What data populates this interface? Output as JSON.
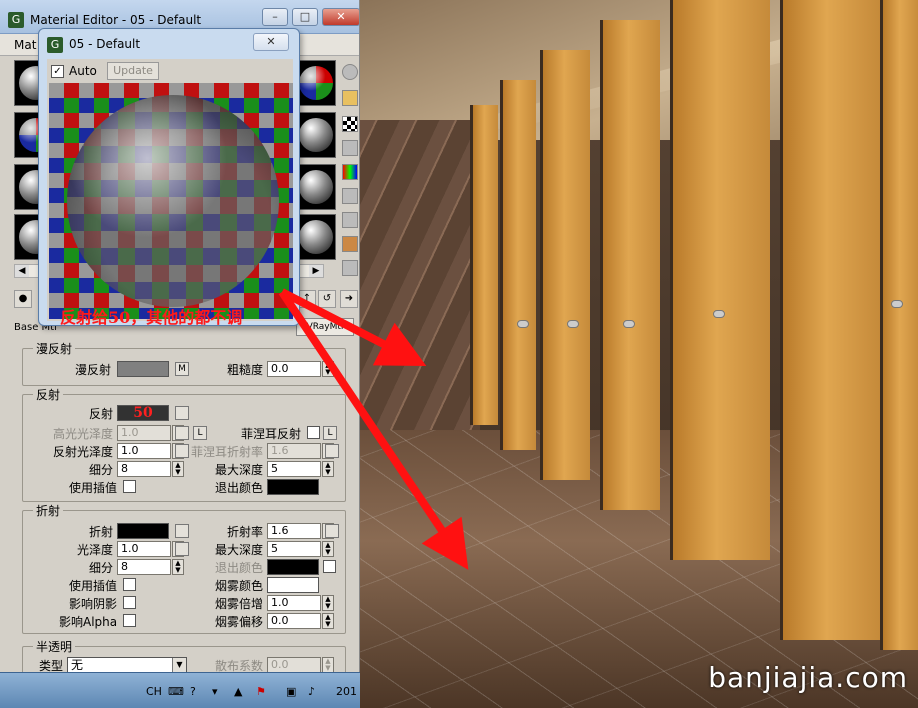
{
  "main_window": {
    "title": "Material Editor - 05 - Default",
    "min_glyph": "–",
    "max_glyph": "□",
    "close_glyph": "✕",
    "menu_partial": "Mat"
  },
  "sample_window": {
    "title": "05 - Default",
    "close_glyph": "✕",
    "auto_label": "Auto",
    "auto_checked": "✓",
    "update_label": "Update",
    "annotation": "反射给50，其他的都不调"
  },
  "base_mtl_label": "Base Mtl",
  "raymtl_label": "VRayMtl",
  "diffuse": {
    "title": "漫反射",
    "diffuse_label": "漫反射",
    "map_btn": "M",
    "roughness_label": "粗糙度",
    "roughness_value": "0.0",
    "swatch_color": "#808080"
  },
  "reflection": {
    "title": "反射",
    "reflect_label": "反射",
    "reflect_value": "50",
    "reflect_color": "#323232",
    "hilight_gloss_label": "高光光泽度",
    "hilight_gloss_value": "1.0",
    "lock_btn": "L",
    "fresnel_label": "菲涅耳反射",
    "fresnel_lock": "L",
    "refl_gloss_label": "反射光泽度",
    "refl_gloss_value": "1.0",
    "fresnel_ior_label": "菲涅耳折射率",
    "fresnel_ior_value": "1.6",
    "subdivs_label": "细分",
    "subdivs_value": "8",
    "max_depth_label": "最大深度",
    "max_depth_value": "5",
    "use_interp_label": "使用插值",
    "exit_color_label": "退出颜色",
    "exit_color": "#000000"
  },
  "refraction": {
    "title": "折射",
    "refract_label": "折射",
    "refract_color": "#000000",
    "ior_label": "折射率",
    "ior_value": "1.6",
    "gloss_label": "光泽度",
    "gloss_value": "1.0",
    "max_depth_label": "最大深度",
    "max_depth_value": "5",
    "subdivs_label": "细分",
    "subdivs_value": "8",
    "exit_color_label": "退出颜色",
    "exit_color": "#000000",
    "use_interp_label": "使用插值",
    "fog_color_label": "烟雾颜色",
    "fog_color": "#ffffff",
    "affect_shadows_label": "影响阴影",
    "fog_mult_label": "烟雾倍增",
    "fog_mult_value": "1.0",
    "affect_alpha_label": "影响Alpha",
    "fog_bias_label": "烟雾偏移",
    "fog_bias_value": "0.0"
  },
  "translucency": {
    "title": "半透明",
    "type_label": "类型",
    "type_value": "无",
    "scatter_label": "散布系数",
    "scatter_value": "0.0"
  },
  "taskbar": {
    "lang": "CH",
    "year_partial": "201"
  },
  "watermark": "banjiajia.com",
  "colors": {
    "arrow": "#ff1111",
    "annotation": "#ff1a1a"
  }
}
